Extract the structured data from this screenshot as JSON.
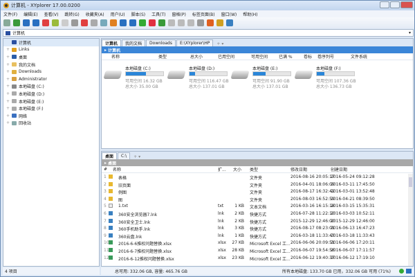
{
  "title": "计算机 - XYplorer 17.00.0200",
  "menu": [
    "文件(F)",
    "编辑(E)",
    "查看(V)",
    "跳转(G)",
    "收藏夹(A)",
    "用户(U)",
    "脚本(S)",
    "工具(T)",
    "窗格(P)",
    "标签页面(B)",
    "窗口(W)",
    "帮助(H)"
  ],
  "address": "计算机",
  "tree": [
    {
      "label": "计算机",
      "icon": "computer-icon",
      "color": "#2a4fa0"
    },
    {
      "label": "Links",
      "icon": "links-icon",
      "color": "#e0a020"
    },
    {
      "label": "桌面",
      "icon": "desktop-icon",
      "color": "#2a5da8"
    },
    {
      "label": "我的文档",
      "icon": "documents-icon",
      "color": "#e8c060"
    },
    {
      "label": "Downloads",
      "icon": "downloads-icon",
      "color": "#e0b040"
    },
    {
      "label": "Administrator",
      "icon": "user-icon",
      "color": "#d8a040"
    },
    {
      "label": "本地磁盘 (C:)",
      "icon": "drive-icon",
      "color": "#888"
    },
    {
      "label": "本地磁盘 (D:)",
      "icon": "drive-icon",
      "color": "#aaa"
    },
    {
      "label": "本地磁盘 (E:)",
      "icon": "drive-icon",
      "color": "#aaa"
    },
    {
      "label": "本地磁盘 (F:)",
      "icon": "drive-icon",
      "color": "#aaa"
    },
    {
      "label": "网络",
      "icon": "network-icon",
      "color": "#3a70c0"
    },
    {
      "label": "回收站",
      "icon": "recycle-bin-icon",
      "color": "#8aa"
    }
  ],
  "top_pane": {
    "tabs": [
      "计算机",
      "我的文档",
      "Downloads",
      "E:\\XYplorer\\HP"
    ],
    "crumb": "计算机",
    "headers": [
      "名称",
      "类型",
      "总大小",
      "已用空间",
      "可用空间",
      "已满 %",
      "卷标",
      "卷序列号",
      "文件系统"
    ],
    "drives": [
      {
        "name": "本地磁盘 (C:)",
        "free": "可用空间 16.32 GB",
        "total": "总大小 35.00 GB",
        "used_pct": 53
      },
      {
        "name": "本地磁盘 (D:)",
        "free": "可用空间 116.47 GB",
        "total": "总大小 137.01 GB",
        "used_pct": 15
      },
      {
        "name": "本地磁盘 (E:)",
        "free": "可用空间 91.90 GB",
        "total": "总大小 137.01 GB",
        "used_pct": 33
      },
      {
        "name": "本地磁盘 (F:)",
        "free": "可用空间 107.36 GB",
        "total": "总大小 136.73 GB",
        "used_pct": 21
      }
    ]
  },
  "bottom_pane": {
    "tabs": [
      "桌面",
      "C:\\"
    ],
    "crumb": "桌面",
    "headers": [
      "#",
      "名称",
      "扩...",
      "大小",
      "类型",
      "修改日期",
      "创建日期"
    ],
    "rows": [
      [
        "1",
        "表格",
        "",
        "",
        "文件夹",
        "2016-08-16 20:05:17",
        "2016-05-24 09:12:28"
      ],
      [
        "2",
        "旧页面",
        "",
        "",
        "文件夹",
        "2016-04-01 18:06:09",
        "2016-03-11 17:45:50"
      ],
      [
        "3",
        "例图",
        "",
        "",
        "文件夹",
        "2016-08-17 16:32:42",
        "2016-03-01 13:52:48"
      ],
      [
        "4",
        "图",
        "",
        "",
        "文件夹",
        "2016-08-03 16:52:59",
        "2016-04-21 08:39:50"
      ],
      [
        "5",
        "1.txt",
        "txt",
        "1 KB",
        "文本文档",
        "2016-03-16 16:15:18",
        "2016-03-15 15:35:31"
      ],
      [
        "6",
        "360安全浏览器7.lnk",
        "lnk",
        "2 KB",
        "快捷方式",
        "2016-07-28 11:22:10",
        "2016-03-03 10:52:11"
      ],
      [
        "7",
        "360安全卫士.lnk",
        "lnk",
        "2 KB",
        "快捷方式",
        "2015-12-29 12:46:00",
        "2015-12-29 12:46:00"
      ],
      [
        "8",
        "360手机助手.lnk",
        "lnk",
        "3 KB",
        "快捷方式",
        "2016-08-17 08:23:01",
        "2016-06-13 16:47:23"
      ],
      [
        "9",
        "360云盘.lnk",
        "lnk",
        "1 KB",
        "快捷方式",
        "2016-03-18 11:33:43",
        "2016-03-18 11:33:43"
      ],
      [
        "10",
        "2016-6-6推权问题替换.xlsx",
        "xlsx",
        "27 KB",
        "Microsoft Excel 工...",
        "2016-06-06 20:09:51",
        "2016-06-06 17:20:11"
      ],
      [
        "11",
        "2016-6-7推权问题替换.xlsx",
        "xlsx",
        "28 KB",
        "Microsoft Excel 工...",
        "2016-06-07 19:54:56",
        "2016-06-07 17:11:57"
      ],
      [
        "12",
        "2016-6-12推权问题替换.xlsx",
        "xlsx",
        "23 KB",
        "Microsoft Excel 工...",
        "2016-06-12 19:40:37",
        "2016-06-12 17:19:10"
      ]
    ]
  },
  "status": {
    "items": "4 项目",
    "free": "总可用: 332.06 GB, 容量: 465.76 GB",
    "drives": "所有本地磁盘: 133.70 GB 已用，332.06 GB 可用 (71%)"
  },
  "accent": "#3b86d8"
}
